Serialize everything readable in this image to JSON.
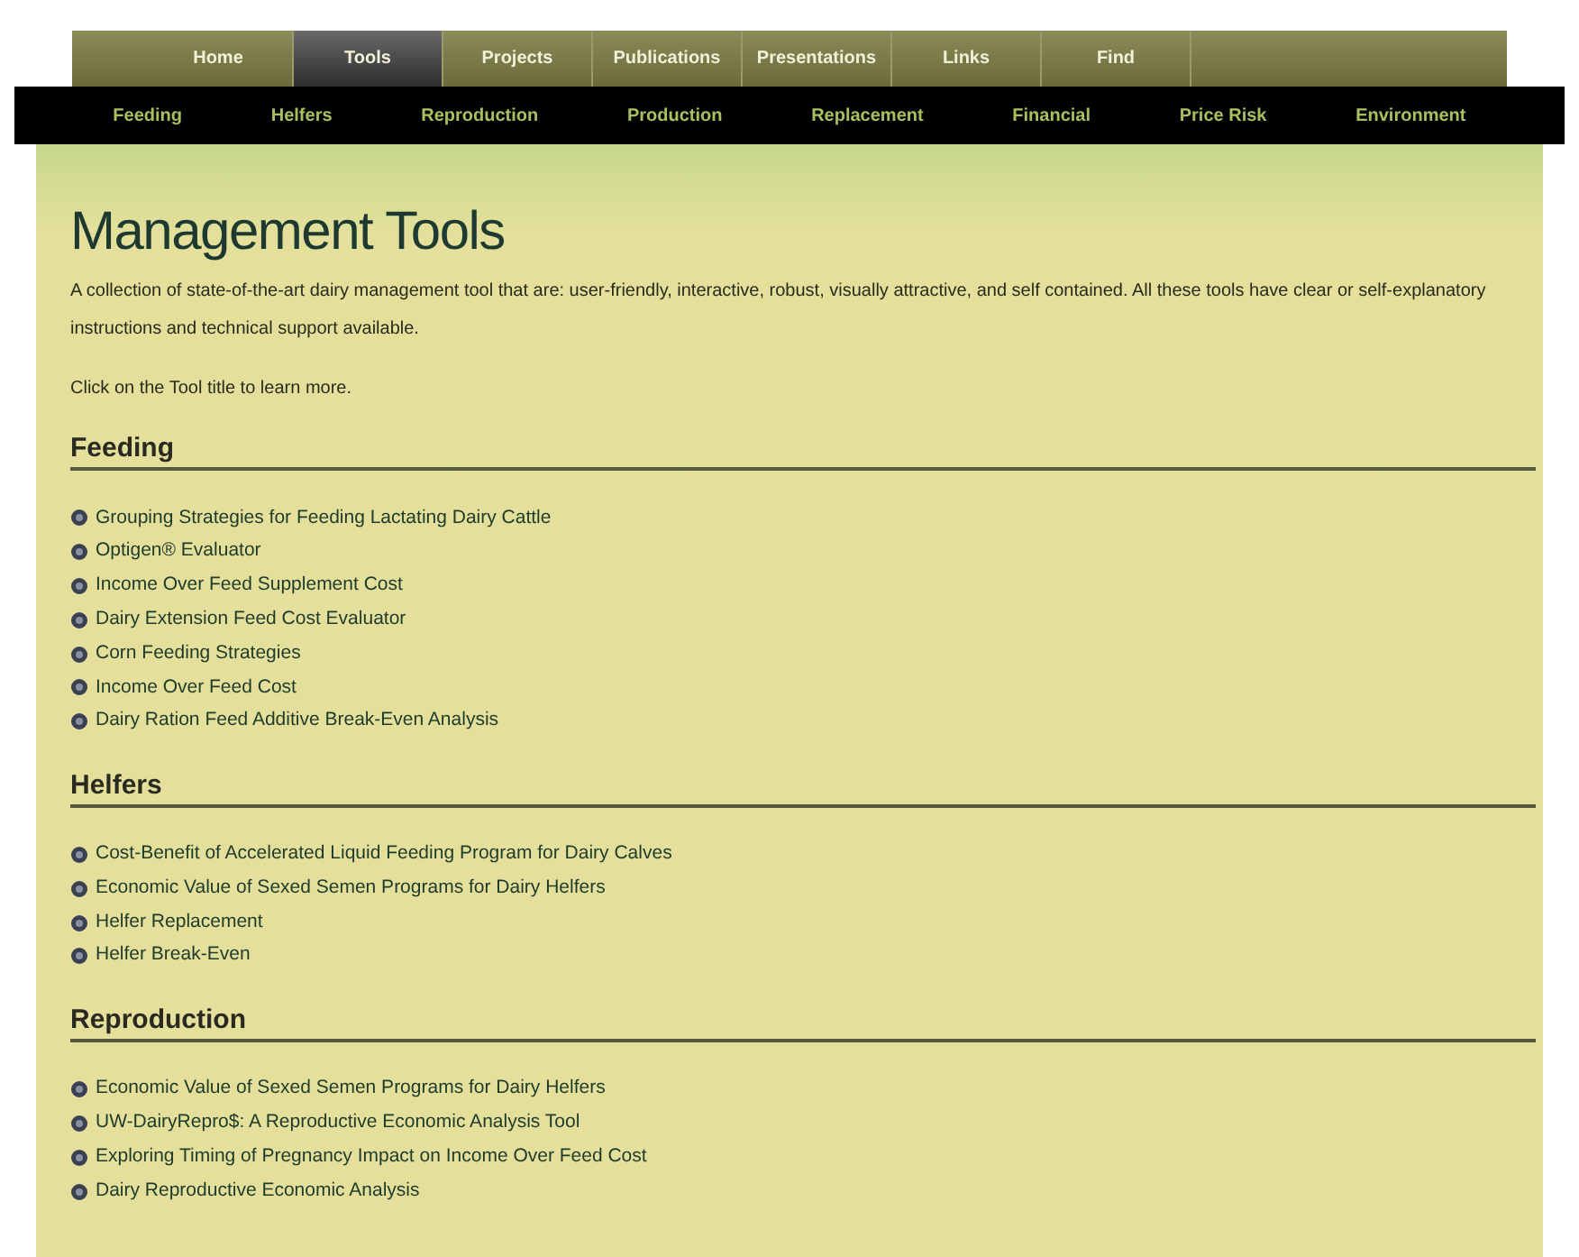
{
  "main_nav": [
    {
      "label": "Home",
      "selected": false
    },
    {
      "label": "Tools",
      "selected": true
    },
    {
      "label": "Projects",
      "selected": false
    },
    {
      "label": "Publications",
      "selected": false
    },
    {
      "label": "Presentations",
      "selected": false
    },
    {
      "label": "Links",
      "selected": false
    },
    {
      "label": "Find",
      "selected": false
    }
  ],
  "sub_nav": [
    "Feeding",
    "Helfers",
    "Reproduction",
    "Production",
    "Replacement",
    "Financial",
    "Price Risk",
    "Environment"
  ],
  "title": "Management Tools",
  "intro": "A collection of state-of-the-art dairy management tool that are: user-friendly, interactive, robust, visually attractive, and self contained. All these tools have clear or self-explanatory instructions and technical support available.",
  "hint": "Click on the Tool title to learn more.",
  "sections": [
    {
      "heading": "Feeding",
      "links": [
        "Grouping Strategies for Feeding Lactating Dairy Cattle",
        "Optigen® Evaluator",
        "Income Over Feed Supplement Cost",
        "Dairy Extension Feed Cost Evaluator",
        "Corn Feeding Strategies",
        "Income Over Feed Cost",
        "Dairy Ration Feed Additive Break-Even Analysis"
      ]
    },
    {
      "heading": "Helfers",
      "links": [
        "Cost-Benefit of Accelerated Liquid Feeding Program for Dairy Calves",
        "Economic Value of Sexed Semen Programs for Dairy Helfers",
        "Helfer Replacement",
        "Helfer Break-Even"
      ]
    },
    {
      "heading": "Reproduction",
      "links": [
        "Economic Value of Sexed Semen Programs for Dairy Helfers",
        "UW-DairyRepro$: A Reproductive Economic Analysis Tool",
        "Exploring Timing of Pregnancy Impact on Income Over Feed Cost",
        "Dairy Reproductive Economic Analysis"
      ]
    }
  ]
}
